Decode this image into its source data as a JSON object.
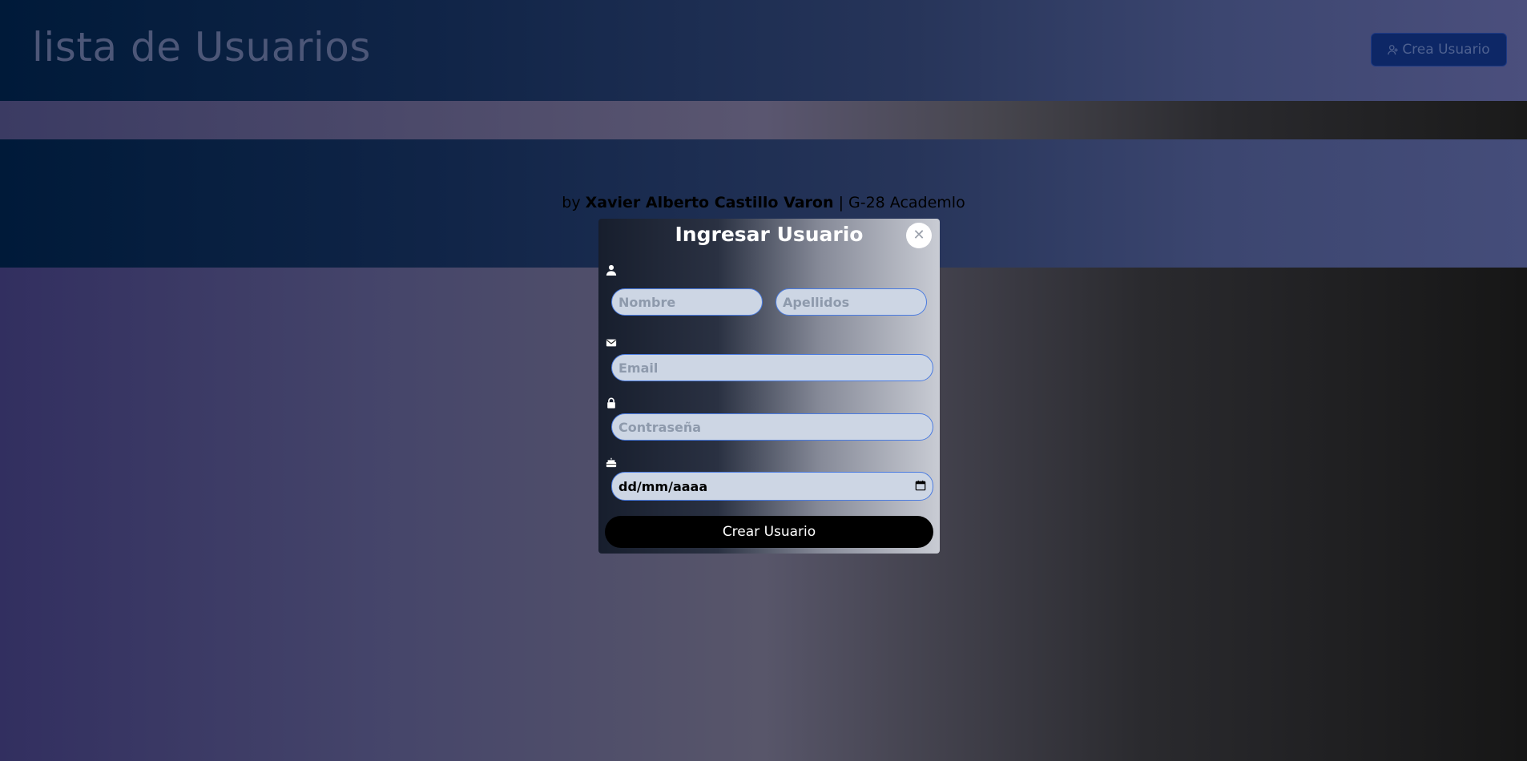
{
  "header": {
    "title": "lista de Usuarios",
    "create_button_label": "Crea Usuario",
    "create_button_icon": "user-plus-icon"
  },
  "credits": {
    "prefix": "by",
    "author": "Xavier Alberto Castillo Varon",
    "suffix": "| G-28 Academlo"
  },
  "modal": {
    "title": "Ingresar Usuario",
    "close_icon": "close-icon",
    "fields": {
      "first_name": {
        "placeholder": "Nombre",
        "value": "",
        "icon": "user-icon"
      },
      "last_name": {
        "placeholder": "Apellidos",
        "value": ""
      },
      "email": {
        "placeholder": "Email",
        "value": "",
        "icon": "envelope-icon"
      },
      "password": {
        "placeholder": "Contraseña",
        "value": "",
        "icon": "lock-icon"
      },
      "birthday": {
        "placeholder": "dd/mm/aaaa",
        "value": "",
        "icon": "cake-icon"
      }
    },
    "submit_label": "Crear Usuario"
  },
  "colors": {
    "accent": "#4a7be0",
    "create_button_bg": "#0d2766",
    "submit_bg": "#000000"
  }
}
